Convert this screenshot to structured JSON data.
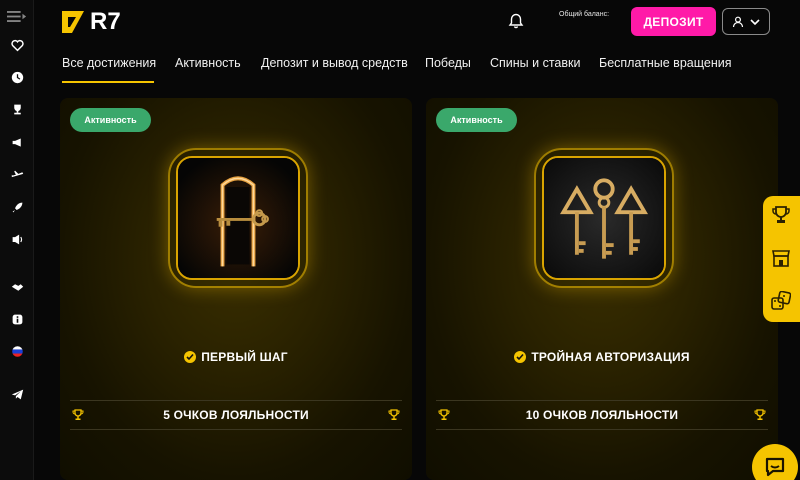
{
  "header": {
    "logo_text": "R7",
    "balance_label": "Общий баланс:",
    "deposit_label": "ДЕПОЗИТ",
    "icons": {
      "bell": "bell-icon",
      "user": "user-icon",
      "chevron": "chevron-down-icon"
    }
  },
  "sidebar": {
    "items": [
      "menu-toggle-icon",
      "heart-icon",
      "clock-icon",
      "trophy-icon",
      "megaphone-icon",
      "plane-icon",
      "rocket-icon",
      "loudspeaker-icon",
      "handshake-icon",
      "info-icon",
      "russia-flag-icon",
      "telegram-icon"
    ]
  },
  "tabs": [
    {
      "label": "Все достижения",
      "active": true
    },
    {
      "label": "Активность",
      "active": false
    },
    {
      "label": "Депозит и вывод средств",
      "active": false
    },
    {
      "label": "Победы",
      "active": false
    },
    {
      "label": "Спины и ставки",
      "active": false
    },
    {
      "label": "Бесплатные вращения",
      "active": false
    }
  ],
  "cards": [
    {
      "badge": "Активность",
      "title": "ПЕРВЫЙ ШАГ",
      "points": "5 ОЧКОВ ЛОЯЛЬНОСТИ",
      "image": "glowing-door-with-key"
    },
    {
      "badge": "Активность",
      "title": "ТРОЙНАЯ АВТОРИЗАЦИЯ",
      "points": "10 ОЧКОВ ЛОЯЛЬНОСТИ",
      "image": "three-keys"
    }
  ],
  "float_panel": [
    "trophy-icon",
    "store-icon",
    "dice-icon"
  ],
  "colors": {
    "accent": "#f5c400",
    "deposit": "#ff1aa8",
    "badge": "#3aa86b",
    "background": "#070707"
  }
}
